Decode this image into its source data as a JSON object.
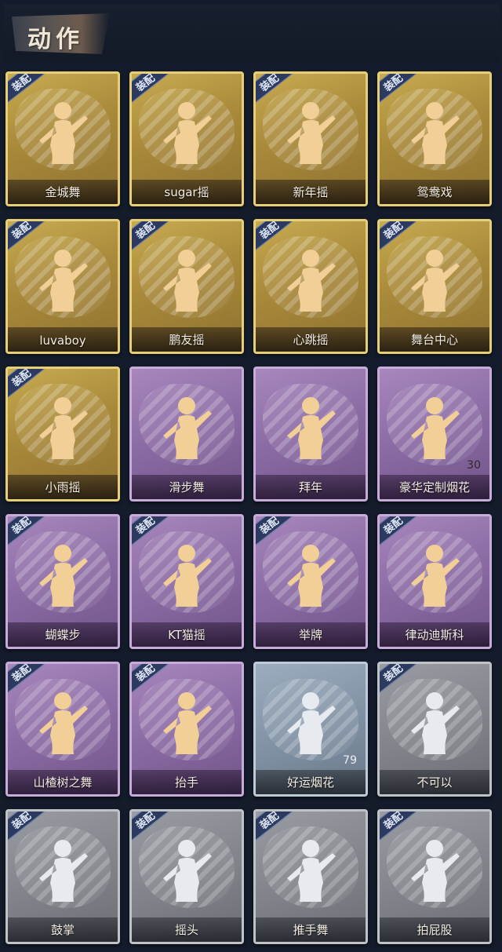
{
  "header": {
    "title": "动作"
  },
  "colors": {
    "gold": "#b49640",
    "purple": "#8a6aa3",
    "blue": "#7f90a2",
    "gray": "#7f8288",
    "equip_badge": "#2b3a5e",
    "background": "#141c2b"
  },
  "cards": [
    {
      "label": "金城舞",
      "tier": "gold",
      "equipped": true,
      "equip_text": "装配",
      "icon": "dance-pose-icon"
    },
    {
      "label": "sugar摇",
      "tier": "gold",
      "equipped": true,
      "equip_text": "装配",
      "icon": "dance-pose-icon"
    },
    {
      "label": "新年摇",
      "tier": "gold",
      "equipped": true,
      "equip_text": "装配",
      "icon": "dance-pose-icon"
    },
    {
      "label": "鸳鸯戏",
      "tier": "gold",
      "equipped": true,
      "equip_text": "装配",
      "icon": "dance-pose-icon"
    },
    {
      "label": "luvaboy",
      "tier": "gold",
      "equipped": true,
      "equip_text": "装配",
      "icon": "dance-pose-icon"
    },
    {
      "label": "鹏友摇",
      "tier": "gold",
      "equipped": true,
      "equip_text": "装配",
      "icon": "dance-pose-icon"
    },
    {
      "label": "心跳摇",
      "tier": "gold",
      "equipped": true,
      "equip_text": "装配",
      "icon": "dance-pose-icon"
    },
    {
      "label": "舞台中心",
      "tier": "gold",
      "equipped": true,
      "equip_text": "装配",
      "icon": "dance-pose-icon"
    },
    {
      "label": "小雨摇",
      "tier": "gold",
      "equipped": true,
      "equip_text": "装配",
      "icon": "dance-pose-icon"
    },
    {
      "label": "滑步舞",
      "tier": "purple",
      "equipped": false,
      "icon": "dance-pose-icon"
    },
    {
      "label": "拜年",
      "tier": "purple",
      "equipped": false,
      "icon": "bow-pose-icon"
    },
    {
      "label": "豪华定制烟花",
      "tier": "purple",
      "equipped": false,
      "icon": "fireworks-box-icon",
      "count": "30"
    },
    {
      "label": "蝴蝶步",
      "tier": "purple",
      "equipped": true,
      "equip_text": "装配",
      "icon": "dance-pose-icon"
    },
    {
      "label": "KT猫摇",
      "tier": "purple",
      "equipped": true,
      "equip_text": "装配",
      "icon": "dance-pose-icon"
    },
    {
      "label": "举牌",
      "tier": "purple",
      "equipped": true,
      "equip_text": "装配",
      "icon": "sign-holding-icon"
    },
    {
      "label": "律动迪斯科",
      "tier": "purple",
      "equipped": true,
      "equip_text": "装配",
      "icon": "disco-pose-icon"
    },
    {
      "label": "山楂树之舞",
      "tier": "purple",
      "equipped": true,
      "equip_text": "装配",
      "icon": "dance-pose-icon"
    },
    {
      "label": "抬手",
      "tier": "purple",
      "equipped": true,
      "equip_text": "装配",
      "icon": "raise-hand-icon"
    },
    {
      "label": "好运烟花",
      "tier": "blue",
      "equipped": false,
      "icon": "firework-can-icon",
      "count": "79"
    },
    {
      "label": "不可以",
      "tier": "gray",
      "equipped": true,
      "equip_text": "装配",
      "icon": "finger-wag-icon"
    },
    {
      "label": "鼓掌",
      "tier": "gray",
      "equipped": true,
      "equip_text": "装配",
      "icon": "clapping-hands-icon"
    },
    {
      "label": "摇头",
      "tier": "gray",
      "equipped": true,
      "equip_text": "装配",
      "icon": "head-shake-icon"
    },
    {
      "label": "推手舞",
      "tier": "gray",
      "equipped": true,
      "equip_text": "装配",
      "icon": "push-dance-icon"
    },
    {
      "label": "拍屁股",
      "tier": "gray",
      "equipped": true,
      "equip_text": "装配",
      "icon": "pat-pose-icon"
    }
  ]
}
